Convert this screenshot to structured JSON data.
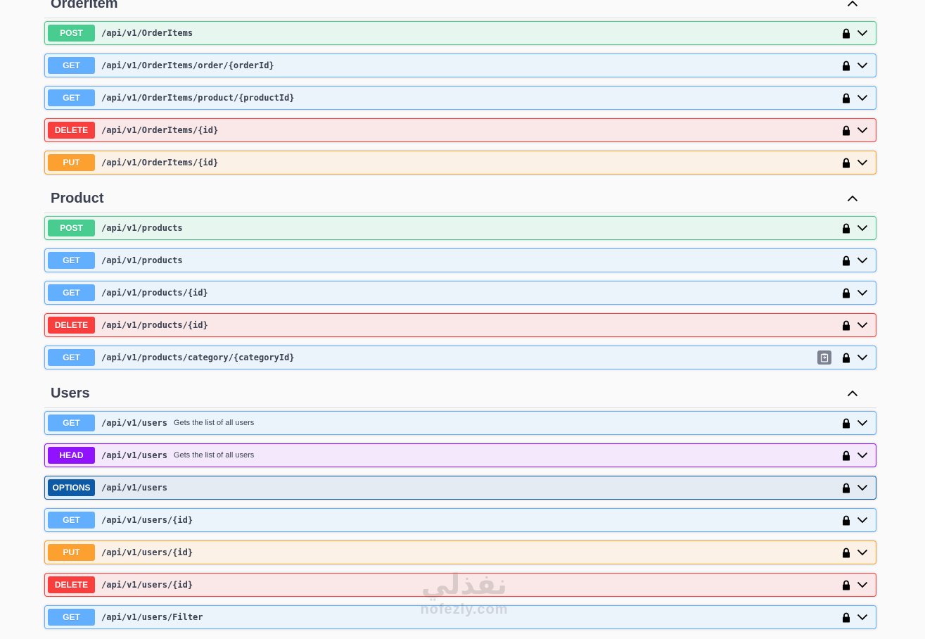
{
  "colors": {
    "POST": {
      "badge": "#49cc90",
      "bg": "#e8f6f0",
      "border": "#49cc90"
    },
    "GET": {
      "badge": "#61affe",
      "bg": "#ebf3fb",
      "border": "#61affe"
    },
    "DELETE": {
      "badge": "#f93e3e",
      "bg": "#fae7e7",
      "border": "#f93e3e"
    },
    "PUT": {
      "badge": "#fca130",
      "bg": "#fbf1e6",
      "border": "#fca130"
    },
    "HEAD": {
      "badge": "#9012fe",
      "bg": "#f3e8fc",
      "border": "#9012fe"
    },
    "OPTIONS": {
      "badge": "#0d5aa7",
      "bg": "#e4ebf3",
      "border": "#0d5aa7"
    }
  },
  "sections": [
    {
      "title": "OrderItem",
      "operations": [
        {
          "method": "POST",
          "path": "/api/v1/OrderItems",
          "summary": ""
        },
        {
          "method": "GET",
          "path": "/api/v1/OrderItems/order/{orderId}",
          "summary": ""
        },
        {
          "method": "GET",
          "path": "/api/v1/OrderItems/product/{productId}",
          "summary": ""
        },
        {
          "method": "DELETE",
          "path": "/api/v1/OrderItems/{id}",
          "summary": ""
        },
        {
          "method": "PUT",
          "path": "/api/v1/OrderItems/{id}",
          "summary": ""
        }
      ]
    },
    {
      "title": "Product",
      "operations": [
        {
          "method": "POST",
          "path": "/api/v1/products",
          "summary": ""
        },
        {
          "method": "GET",
          "path": "/api/v1/products",
          "summary": ""
        },
        {
          "method": "GET",
          "path": "/api/v1/products/{id}",
          "summary": ""
        },
        {
          "method": "DELETE",
          "path": "/api/v1/products/{id}",
          "summary": ""
        },
        {
          "method": "GET",
          "path": "/api/v1/products/category/{categoryId}",
          "summary": "",
          "copy_button": true
        }
      ]
    },
    {
      "title": "Users",
      "operations": [
        {
          "method": "GET",
          "path": "/api/v1/users",
          "summary": "Gets the list of all users"
        },
        {
          "method": "HEAD",
          "path": "/api/v1/users",
          "summary": "Gets the list of all users"
        },
        {
          "method": "OPTIONS",
          "path": "/api/v1/users",
          "summary": ""
        },
        {
          "method": "GET",
          "path": "/api/v1/users/{id}",
          "summary": ""
        },
        {
          "method": "PUT",
          "path": "/api/v1/users/{id}",
          "summary": ""
        },
        {
          "method": "DELETE",
          "path": "/api/v1/users/{id}",
          "summary": ""
        },
        {
          "method": "GET",
          "path": "/api/v1/users/Filter",
          "summary": ""
        }
      ]
    }
  ],
  "icons": {
    "lock": "lock-icon",
    "expand": "chevron-down-icon",
    "collapse": "chevron-up-icon",
    "copy": "copy-icon"
  },
  "watermark": {
    "arabic": "نفذلي",
    "latin": "nofezly.com"
  }
}
